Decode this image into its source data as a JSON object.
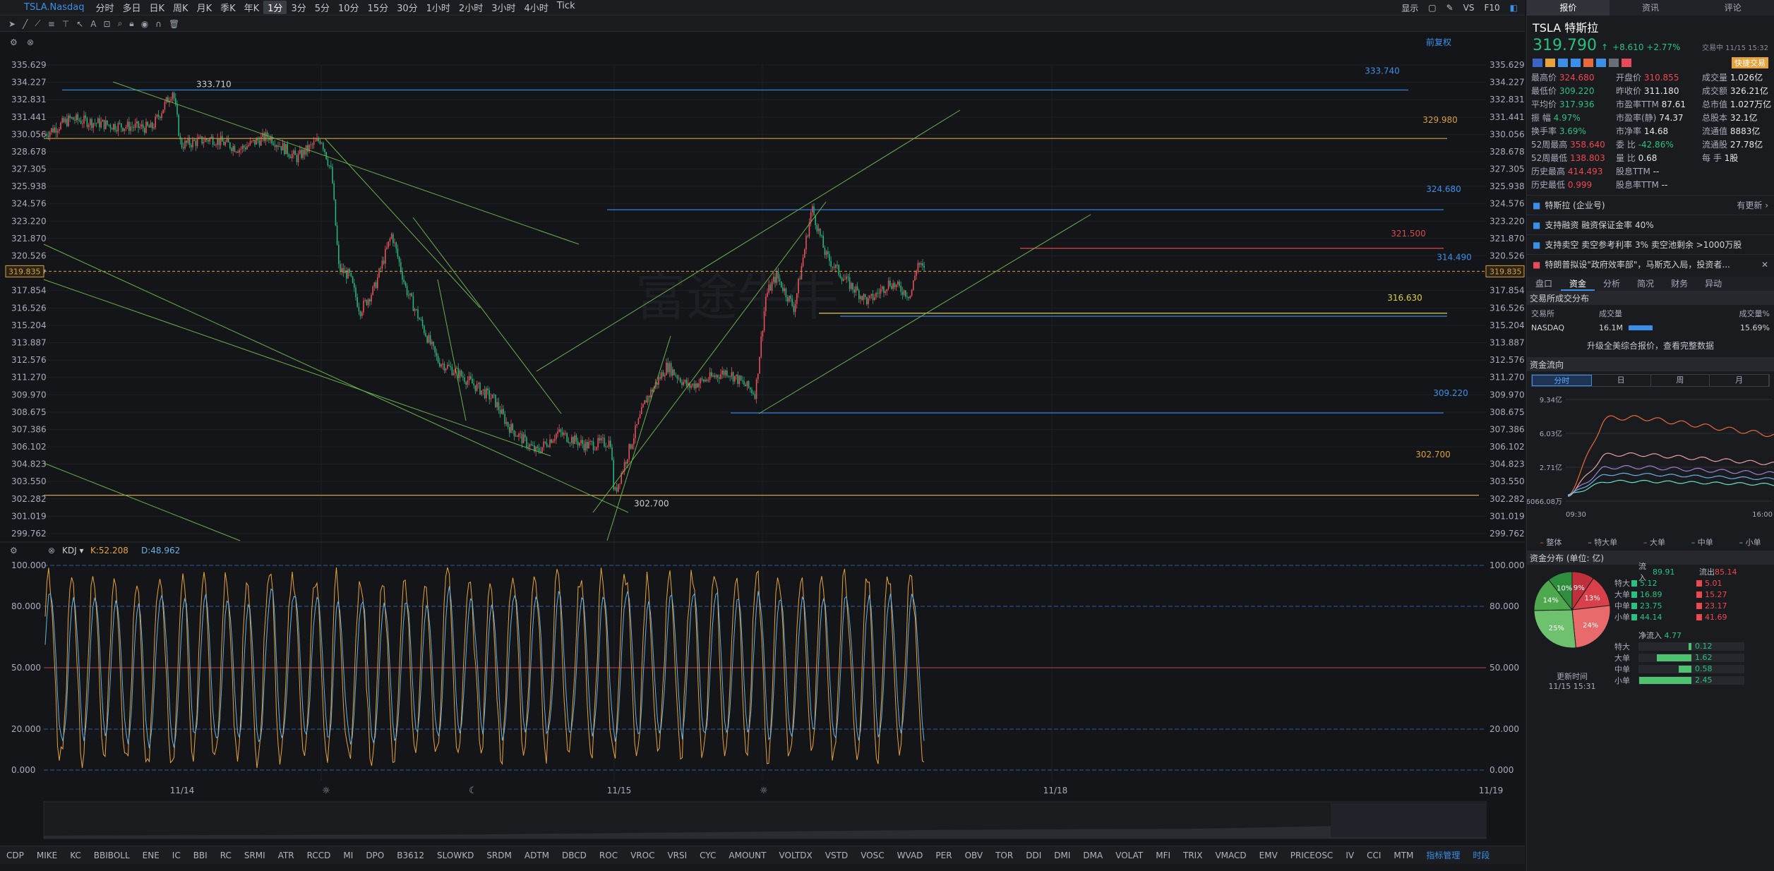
{
  "topbar": {
    "symbol": "TSLA.Nasdaq",
    "timeframes": [
      "分时",
      "多日",
      "日K",
      "周K",
      "月K",
      "季K",
      "年K",
      "1分",
      "3分",
      "5分",
      "10分",
      "15分",
      "30分",
      "1小时",
      "2小时",
      "3小时",
      "4小时",
      "Tick"
    ],
    "active": "1分",
    "display": "显示",
    "vs": "VS",
    "f10": "F10"
  },
  "chart": {
    "adjust": "前复权",
    "axis_labels": [
      "335.629",
      "334.227",
      "332.831",
      "331.441",
      "330.056",
      "328.678",
      "327.305",
      "325.938",
      "324.576",
      "323.220",
      "321.870",
      "320.526",
      "319.187",
      "317.854",
      "316.526",
      "315.204",
      "313.887",
      "312.576",
      "311.270",
      "309.970",
      "308.675",
      "307.386",
      "306.102",
      "304.823",
      "303.550",
      "302.282",
      "301.019",
      "299.762"
    ],
    "current_price": "319.835",
    "annotations": {
      "high_left": "333.710",
      "low": "302.700",
      "alerts": [
        "333.740",
        "329.980",
        "324.680",
        "321.500",
        "316.630",
        "314.490",
        "309.220",
        "302.700"
      ]
    },
    "indicator": {
      "name": "KDJ",
      "k": "K:52.208",
      "d": "D:48.962",
      "levels": [
        "100.000",
        "80.000",
        "50.000",
        "20.000",
        "0.000"
      ]
    },
    "dates": [
      "11/14",
      "11/15",
      "11/18",
      "11/19"
    ],
    "watermark": "富途牛牛"
  },
  "indicators": [
    "CDP",
    "MIKE",
    "KC",
    "BBIBOLL",
    "ENE",
    "IC",
    "BBI",
    "RC",
    "SRMI",
    "ATR",
    "RCCD",
    "MI",
    "DPO",
    "B3612",
    "SLOWKD",
    "SRDM",
    "ADTM",
    "DBCD",
    "ROC",
    "VROC",
    "VRSI",
    "CYC",
    "AMOUNT",
    "VOLTDX",
    "VSTD",
    "VOSC",
    "WVAD",
    "PER",
    "OBV",
    "TOR",
    "DDI",
    "DMI",
    "DMA",
    "VOLAT",
    "MFI",
    "TRIX",
    "VMACD",
    "EMV",
    "PRICEOSC",
    "IV",
    "CCI",
    "MTM"
  ],
  "indicator_manage": "指标管理",
  "period": "时段",
  "right": {
    "tabs": [
      "报价",
      "资讯",
      "评论"
    ],
    "name": "TSLA 特斯拉",
    "price": "319.790",
    "arrow": "↑",
    "change": "+8.610 +2.77%",
    "status": "交易中 11/15 15:32",
    "quick_trade": "快捷交易",
    "quote": [
      [
        "最高价",
        "324.680",
        "开盘价",
        "310.855",
        "成交量",
        "1.026亿"
      ],
      [
        "最低价",
        "309.220",
        "昨收价",
        "311.180",
        "成交额",
        "326.21亿"
      ],
      [
        "平均价",
        "317.936",
        "市盈率TTM",
        "87.61",
        "总市值",
        "1.027万亿"
      ],
      [
        "振 幅",
        "4.97%",
        "市盈率(静)",
        "74.37",
        "总股本",
        "32.1亿"
      ],
      [
        "换手率",
        "3.69%",
        "市净率",
        "14.68",
        "流通值",
        "8883亿"
      ],
      [
        "52周最高",
        "358.640",
        "委 比",
        "-42.86%",
        "流通股",
        "27.78亿"
      ],
      [
        "52周最低",
        "138.803",
        "量 比",
        "0.68",
        "每 手",
        "1股"
      ],
      [
        "历史最高",
        "414.493",
        "股息TTM",
        "--",
        "",
        ""
      ],
      [
        "历史最低",
        "0.999",
        "股息率TTM",
        "--",
        "",
        ""
      ]
    ],
    "news": [
      {
        "text": "特斯拉 (企业号)",
        "extra": "有更新 ›"
      },
      {
        "text": "支持融资  融资保证金率 40%",
        "extra": ""
      },
      {
        "text": "支持卖空  卖空参考利率 3%  卖空池剩余 >1000万股",
        "extra": ""
      },
      {
        "text": "特朗普拟设\"政府效率部\"，马斯克入局，投资者...",
        "extra": "✕"
      }
    ],
    "subtabs": [
      "盘口",
      "资金",
      "分析",
      "简况",
      "财务",
      "异动"
    ],
    "exchange": {
      "title": "交易所成交分布",
      "cols": [
        "交易所",
        "成交量",
        "成交量%"
      ],
      "row": [
        "NASDAQ",
        "16.1M",
        "15.69%"
      ],
      "upgrade": "升级全美综合报价，查看完整数据"
    },
    "flow": {
      "title": "资金流向",
      "tabs": [
        "分时",
        "日",
        "周",
        "月"
      ],
      "y": [
        "9.34亿",
        "6.03亿",
        "2.71亿",
        "-6066.08万"
      ],
      "x": [
        "09:30",
        "16:00"
      ],
      "legend": [
        "整体",
        "特大单",
        "大单",
        "中单",
        "小单"
      ]
    },
    "dist": {
      "title": "资金分布 (单位: 亿)",
      "inflow_label": "流入",
      "inflow": "89.91",
      "outflow_label": "流出",
      "outflow": "85.14",
      "rows": [
        [
          "特大",
          "5.12",
          "5.01"
        ],
        [
          "大单",
          "16.89",
          "15.27"
        ],
        [
          "中单",
          "23.75",
          "23.17"
        ],
        [
          "小单",
          "44.14",
          "41.69"
        ]
      ],
      "pie": [
        {
          "label": "9%",
          "v": 9,
          "c": "#c0303a"
        },
        {
          "label": "13%",
          "v": 13,
          "c": "#d8404a"
        },
        {
          "label": "24%",
          "v": 24,
          "c": "#e86a6a"
        },
        {
          "label": "25%",
          "v": 25,
          "c": "#6ec26e"
        },
        {
          "label": "14%",
          "v": 14,
          "c": "#4ea84e"
        },
        {
          "label": "10%",
          "v": 10,
          "c": "#2e8e3e"
        }
      ],
      "update_label": "更新时间",
      "update_time": "11/15 15:31",
      "net_label": "净流入",
      "net": "4.77",
      "net_rows": [
        [
          "特大",
          "0.12"
        ],
        [
          "大单",
          "1.62"
        ],
        [
          "中单",
          "0.58"
        ],
        [
          "小单",
          "2.45"
        ]
      ]
    }
  }
}
